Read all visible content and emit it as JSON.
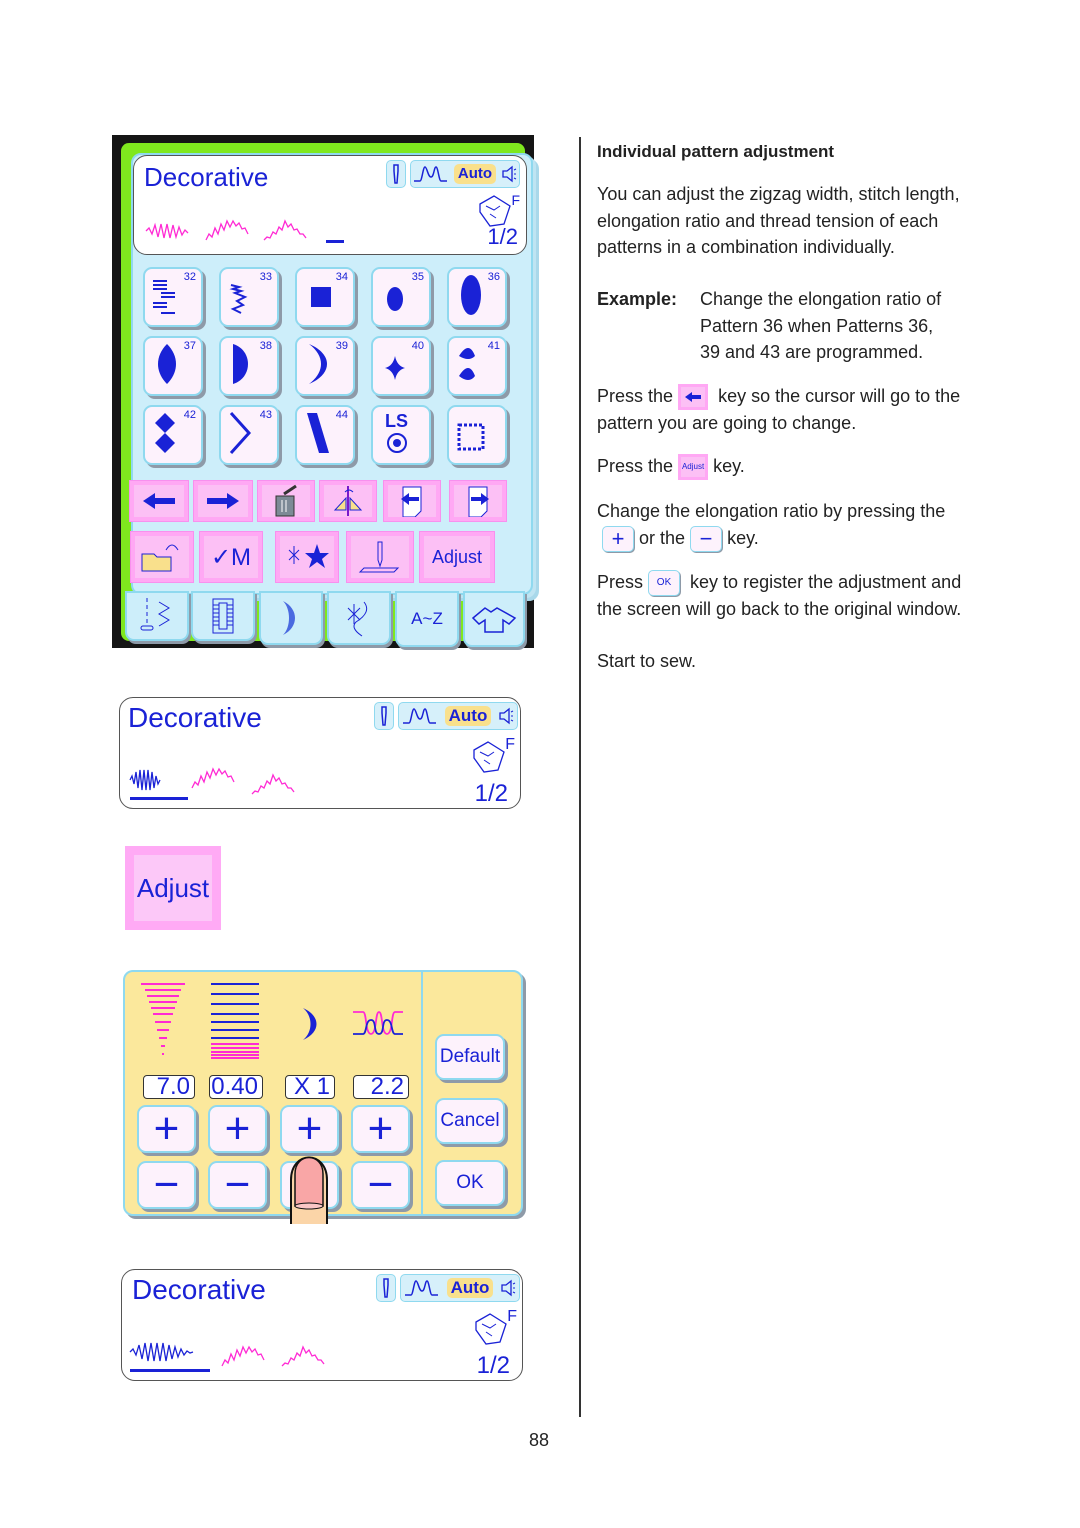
{
  "screen1": {
    "title": "Decorative",
    "auto_label": "Auto",
    "foot_label": "F",
    "page": "1/2",
    "patterns": [
      {
        "num": "32",
        "icon": "zigzag-steps-icon"
      },
      {
        "num": "33",
        "icon": "zigzag-wave-icon"
      },
      {
        "num": "34",
        "icon": "satin-block-icon"
      },
      {
        "num": "35",
        "icon": "small-oval-icon"
      },
      {
        "num": "36",
        "icon": "large-oval-icon"
      },
      {
        "num": "37",
        "icon": "leaf-oval-icon"
      },
      {
        "num": "38",
        "icon": "half-moon-icon"
      },
      {
        "num": "39",
        "icon": "crescent-icon"
      },
      {
        "num": "40",
        "icon": "star-diamond-icon"
      },
      {
        "num": "41",
        "icon": "scallop-pair-icon"
      },
      {
        "num": "42",
        "icon": "diamond-pair-icon"
      },
      {
        "num": "43",
        "icon": "chevron-stitch-icon"
      },
      {
        "num": "44",
        "icon": "slanted-satin-icon"
      },
      {
        "num": "",
        "icon": "ls-lock-stitch-icon",
        "label": "LS"
      },
      {
        "num": "",
        "icon": "dotted-square-icon"
      }
    ],
    "keys_row1": [
      "arrow-left-icon",
      "arrow-right-icon",
      "trash-icon",
      "mirror-icon",
      "page-back-icon",
      "page-forward-icon"
    ],
    "keys_row2": {
      "memory_label": "✓M",
      "adjust_label": "Adjust"
    },
    "tabs": [
      "utility-stitch-icon",
      "buttonhole-icon",
      "satin-stitch-icon",
      "decorative-stitch-icon",
      "A~Z",
      "garment-icon"
    ]
  },
  "screen2": {
    "title": "Decorative",
    "auto_label": "Auto",
    "foot_label": "F",
    "page": "1/2"
  },
  "adjust_key": {
    "label": "Adjust"
  },
  "adjust_panel": {
    "values": [
      "7.0",
      "0.40",
      "X 1",
      "2.2"
    ],
    "param_icons": [
      "zigzag-width-icon",
      "stitch-length-icon",
      "elongation-icon",
      "thread-tension-icon"
    ],
    "plus_label": "+",
    "minus_label": "−",
    "default_label": "Default",
    "cancel_label": "Cancel",
    "ok_label": "OK"
  },
  "screen3": {
    "title": "Decorative",
    "auto_label": "Auto",
    "foot_label": "F",
    "page": "1/2"
  },
  "text": {
    "heading": "Individual pattern adjustment",
    "intro": [
      "You can adjust the zigzag width, stitch length,",
      "elongation ratio and thread tension of each",
      "patterns in a combination individually."
    ],
    "example_label": "Example:",
    "example_lines": [
      "Change the elongation ratio of",
      "Pattern 36 when Patterns 36,",
      "39 and 43 are programmed."
    ],
    "step1_pre": "Press the",
    "step1_post": "key so the cursor will go to the",
    "step1_line2": "pattern you are going to change.",
    "step2_pre": "Press the",
    "step2_key": "Adjust",
    "step2_post": "key.",
    "step3_line1": "Change the elongation ratio by pressing the",
    "step3_mid": "or the",
    "step3_post": "key.",
    "step4_pre": "Press",
    "step4_key": "OK",
    "step4_post": "key to register the adjustment and",
    "step4_line2": "the screen will go back to the original window.",
    "step5": "Start to sew."
  },
  "page_number": "88"
}
